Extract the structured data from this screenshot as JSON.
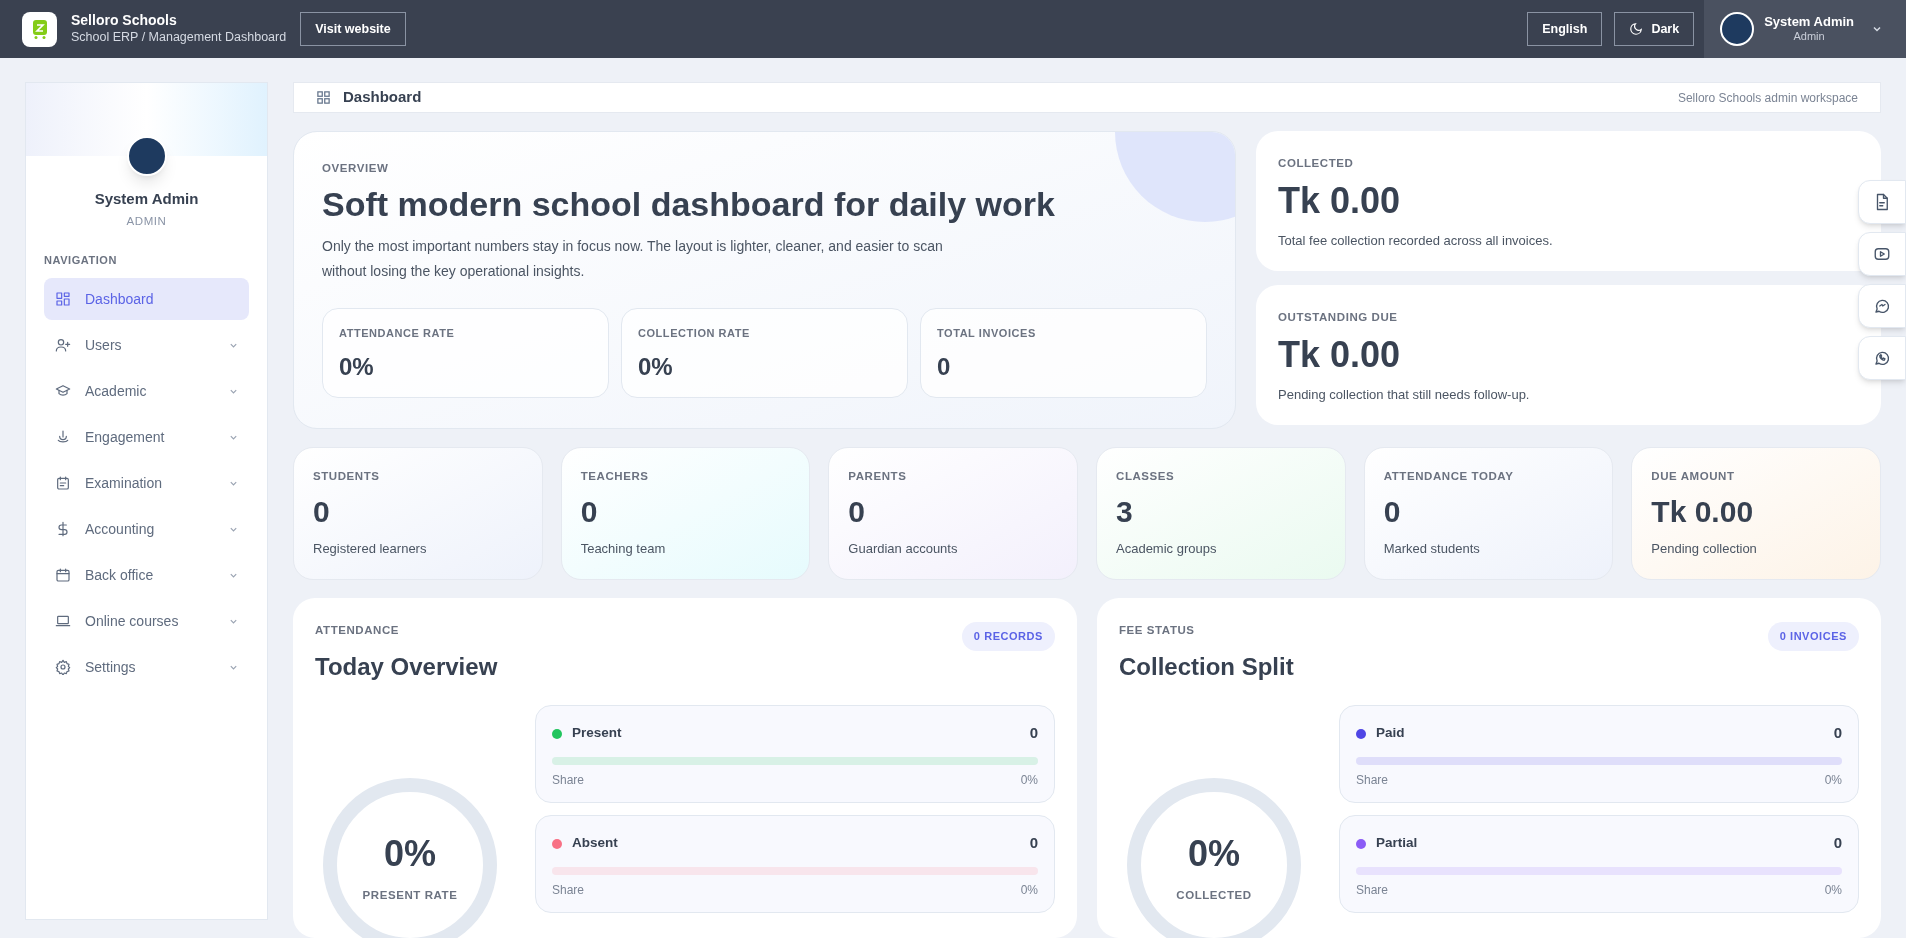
{
  "header": {
    "brand": "Selloro Schools",
    "subtitle": "School ERP / Management Dashboard",
    "visit_button": "Visit website",
    "language_button": "English",
    "theme_button": "Dark",
    "user": {
      "name": "System Admin",
      "role": "Admin"
    }
  },
  "sidebar": {
    "profile": {
      "name": "System Admin",
      "role": "ADMIN"
    },
    "section": "NAVIGATION",
    "items": [
      {
        "label": "Dashboard",
        "selected": true,
        "has_children": false
      },
      {
        "label": "Users",
        "selected": false,
        "has_children": true
      },
      {
        "label": "Academic",
        "selected": false,
        "has_children": true
      },
      {
        "label": "Engagement",
        "selected": false,
        "has_children": true
      },
      {
        "label": "Examination",
        "selected": false,
        "has_children": true
      },
      {
        "label": "Accounting",
        "selected": false,
        "has_children": true
      },
      {
        "label": "Back office",
        "selected": false,
        "has_children": true
      },
      {
        "label": "Online courses",
        "selected": false,
        "has_children": true
      },
      {
        "label": "Settings",
        "selected": false,
        "has_children": true
      }
    ]
  },
  "page_bar": {
    "title": "Dashboard",
    "note": "Selloro Schools admin workspace"
  },
  "overview": {
    "eyebrow": "OVERVIEW",
    "title": "Soft modern school dashboard for daily work",
    "text": "Only the most important numbers stay in focus now. The layout is lighter, cleaner, and easier to scan without losing the key operational insights.",
    "metrics": [
      {
        "label": "ATTENDANCE RATE",
        "value": "0%"
      },
      {
        "label": "COLLECTION RATE",
        "value": "0%"
      },
      {
        "label": "TOTAL INVOICES",
        "value": "0"
      }
    ]
  },
  "summary_cards": [
    {
      "label": "COLLECTED",
      "value": "Tk 0.00",
      "text": "Total fee collection recorded across all invoices."
    },
    {
      "label": "OUTSTANDING DUE",
      "value": "Tk 0.00",
      "text": "Pending collection that still needs follow-up."
    }
  ],
  "stats": [
    {
      "label": "STUDENTS",
      "value": "0",
      "text": "Registered learners"
    },
    {
      "label": "TEACHERS",
      "value": "0",
      "text": "Teaching team"
    },
    {
      "label": "PARENTS",
      "value": "0",
      "text": "Guardian accounts"
    },
    {
      "label": "CLASSES",
      "value": "3",
      "text": "Academic groups"
    },
    {
      "label": "ATTENDANCE TODAY",
      "value": "0",
      "text": "Marked students"
    },
    {
      "label": "DUE AMOUNT",
      "value": "Tk 0.00",
      "text": "Pending collection"
    }
  ],
  "panels": [
    {
      "eyebrow": "ATTENDANCE",
      "title": "Today Overview",
      "badge": "0 RECORDS",
      "ring": {
        "value": "0%",
        "label": "PRESENT RATE",
        "level": 0
      },
      "rows": [
        {
          "label": "Present",
          "count": "0",
          "color": "#22c55e",
          "share_label": "Share",
          "share": "0%",
          "level": 0
        },
        {
          "label": "Absent",
          "count": "0",
          "color": "#f87185",
          "share_label": "Share",
          "share": "0%",
          "level": 0
        }
      ]
    },
    {
      "eyebrow": "FEE STATUS",
      "title": "Collection Split",
      "badge": "0 INVOICES",
      "ring": {
        "value": "0%",
        "label": "COLLECTED",
        "level": 0
      },
      "rows": [
        {
          "label": "Paid",
          "count": "0",
          "color": "#4f46e5",
          "share_label": "Share",
          "share": "0%",
          "level": 0
        },
        {
          "label": "Partial",
          "count": "0",
          "color": "#8b5cf6",
          "share_label": "Share",
          "share": "0%",
          "level": 0
        }
      ]
    }
  ]
}
